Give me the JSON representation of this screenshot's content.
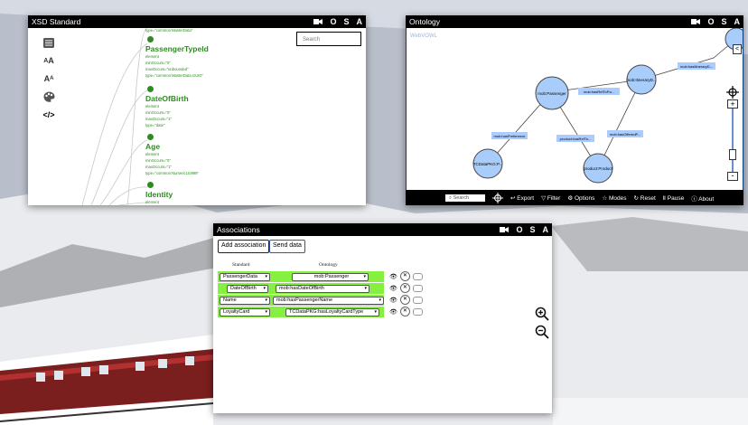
{
  "xsd": {
    "title": "XSD Standard",
    "controls": [
      "O",
      "S",
      "A"
    ],
    "search_placeholder": "Search",
    "tools": [
      {
        "icon": "list-icon",
        "glyph": "☰"
      },
      {
        "icon": "font-size-icon",
        "glyph": "AA"
      },
      {
        "icon": "font-case-icon",
        "glyph": "Aa"
      },
      {
        "icon": "palette-icon",
        "glyph": "🎨"
      },
      {
        "icon": "code-icon",
        "glyph": "</>"
      }
    ],
    "nodes": [
      {
        "name": "PassengerTypeId",
        "attrs": [
          "element",
          "minOccurs=\"0\"",
          "maxOccurs=\"unbounded\"",
          "type=\"common:MasterData.GUID\""
        ]
      },
      {
        "name": "DateOfBirth",
        "attrs": [
          "element",
          "minOccurs=\"0\"",
          "maxOccurs=\"1\"",
          "type=\"date\""
        ]
      },
      {
        "name": "Age",
        "attrs": [
          "element",
          "minOccurs=\"0\"",
          "maxOccurs=\"1\"",
          "type=\"common:Numeric1to999\""
        ]
      },
      {
        "name": "Identity",
        "attrs": [
          "element"
        ]
      }
    ],
    "top_attr": "type=\"common:MasterData\""
  },
  "ontology": {
    "title": "Ontology",
    "controls": [
      "O",
      "S",
      "A"
    ],
    "brand": "WebVOWL",
    "nodes": [
      {
        "label": "mob:Passenger"
      },
      {
        "label": "mob:ItineraryD..."
      },
      {
        "label": "TCDataPKG:P..."
      },
      {
        "label": "product:Product"
      }
    ],
    "edges": [
      {
        "label": "mob:hasItineraryD..."
      },
      {
        "label": "mob:hasRefToPa..."
      },
      {
        "label": "mob:hasPreference"
      },
      {
        "label": "product:hasRefTo..."
      },
      {
        "label": "mob:hasOfferedP..."
      }
    ],
    "search_placeholder": "Search",
    "menu": [
      "Export",
      "Filter",
      "Options",
      "Modes",
      "Reset",
      "Pause",
      "About"
    ],
    "collapse_glyph": "<",
    "zoom_in": "+",
    "zoom_out": "-"
  },
  "associations": {
    "title": "Associations",
    "controls": [
      "O",
      "S",
      "A"
    ],
    "add_button": "Add association",
    "send_button": "Send data",
    "header_standard": "Standard",
    "header_ontology": "Ontology",
    "rows": [
      {
        "standard": "PassengerData",
        "ontology": "mob:Passenger"
      },
      {
        "standard": "DateOfBirth",
        "ontology": "mob:hasDateOfBirth"
      },
      {
        "standard": "Name",
        "ontology": "mob:hasPassengerName"
      },
      {
        "standard": "LoyaltyCard",
        "ontology": "TCDataPKG:hasLoyaltyCardType"
      }
    ]
  },
  "colors": {
    "accent_green": "#85f040",
    "xsd_green": "#2e8b22",
    "node_blue": "#a9cdfa",
    "edge_blue": "#aaccff"
  }
}
